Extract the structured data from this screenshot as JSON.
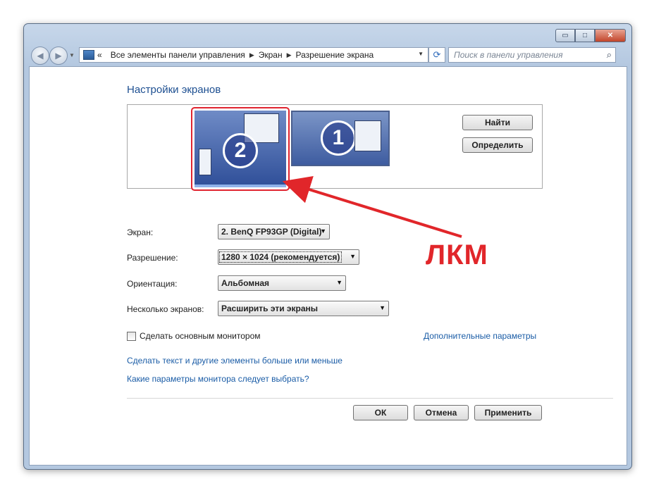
{
  "window": {
    "caption_buttons": {
      "minimize": "▭",
      "maximize": "□",
      "close": "✕"
    }
  },
  "nav": {
    "back_glyph": "◀",
    "forward_glyph": "▶",
    "breadcrumbs_prefix": "«",
    "breadcrumbs": [
      "Все элементы панели управления",
      "Экран",
      "Разрешение экрана"
    ],
    "separator": "▶",
    "address_dropdown": "▼",
    "refresh_glyph": "⟳",
    "search_placeholder": "Поиск в панели управления",
    "search_icon": "magnifier-icon"
  },
  "content": {
    "title": "Настройки экранов",
    "monitors": [
      {
        "number": "1",
        "selected": false
      },
      {
        "number": "2",
        "selected": true
      }
    ],
    "find_button": "Найти",
    "identify_button": "Определить",
    "fields": {
      "display_label": "Экран:",
      "display_value": "2. BenQ FP93GP (Digital)",
      "resolution_label": "Разрешение:",
      "resolution_value": "1280 × 1024 (рекомендуется)",
      "orientation_label": "Ориентация:",
      "orientation_value": "Альбомная",
      "multiple_label": "Несколько экранов:",
      "multiple_value": "Расширить эти экраны"
    },
    "primary_monitor_checkbox": {
      "label": "Сделать основным монитором",
      "checked": false
    },
    "advanced_link": "Дополнительные параметры",
    "text_size_link": "Сделать текст и другие элементы больше или меньше",
    "which_settings_link": "Какие параметры монитора следует выбрать?",
    "ok_button": "ОК",
    "cancel_button": "Отмена",
    "apply_button": "Применить"
  },
  "annotation": {
    "label": "ЛКМ",
    "color": "#e1262a"
  }
}
